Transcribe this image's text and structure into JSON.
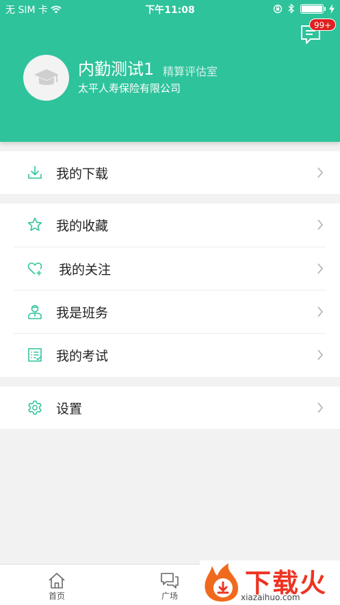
{
  "status_bar": {
    "carrier": "无 SIM 卡",
    "time": "下午11:08"
  },
  "header": {
    "message_badge": "99+",
    "user": {
      "name": "内勤测试1",
      "department": "精算评估室",
      "company": "太平人寿保险有限公司"
    },
    "accent_color": "#2ec39b"
  },
  "menu": {
    "download": {
      "label": "我的下载",
      "icon": "download-icon"
    },
    "favorites": {
      "label": "我的收藏",
      "icon": "star-icon"
    },
    "following": {
      "label": "我的关注",
      "icon": "heart-plus-icon"
    },
    "class_affairs": {
      "label": "我是班务",
      "icon": "person-icon"
    },
    "exams": {
      "label": "我的考试",
      "icon": "checklist-icon"
    },
    "settings": {
      "label": "设置",
      "icon": "gear-icon"
    }
  },
  "tabbar": {
    "home": "首页",
    "square": "广场"
  },
  "watermark": {
    "text": "下载火",
    "url": "xiazaihuo.com"
  }
}
